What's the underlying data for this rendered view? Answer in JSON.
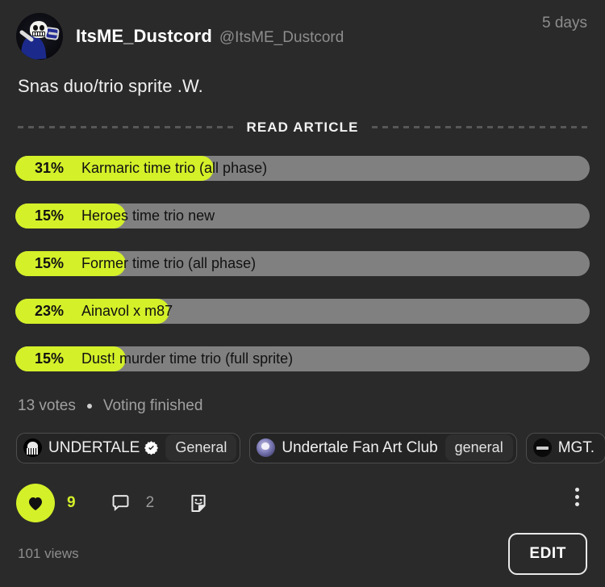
{
  "post": {
    "author": {
      "display_name": "ItsME_Dustcord",
      "handle": "@ItsME_Dustcord",
      "avatar_icon": "sans-skeleton-avatar"
    },
    "timestamp": "5 days",
    "text": "Snas duo/trio sprite .W.",
    "read_article_label": "READ ARTICLE"
  },
  "poll": {
    "options": [
      {
        "percent": "31%",
        "label": "Karmaric time trio (all phase)",
        "value": 31
      },
      {
        "percent": "15%",
        "label": "Heroes time trio new",
        "value": 15
      },
      {
        "percent": "15%",
        "label": "Former time trio (all phase)",
        "value": 15
      },
      {
        "percent": "23%",
        "label": "Ainavol x m87",
        "value": 23
      },
      {
        "percent": "15%",
        "label": "Dust! murder time trio (full sprite)",
        "value": 15
      }
    ],
    "votes_text": "13 votes",
    "status_text": "Voting finished",
    "fill_color": "#d4f029",
    "track_color": "#808080"
  },
  "tags": [
    {
      "name": "UNDERTALE",
      "channel": "General",
      "verified": true,
      "icon": "undertale-server-icon"
    },
    {
      "name": "Undertale Fan Art Club",
      "channel": "general",
      "verified": false,
      "icon": "fanart-server-icon"
    },
    {
      "name": "MGT.",
      "channel": "",
      "verified": false,
      "icon": "mgt-server-icon"
    }
  ],
  "actions": {
    "like_count": "9",
    "comment_count": "2",
    "like_icon": "heart-icon",
    "comment_icon": "comment-bubble-icon",
    "sticker_icon": "sticker-face-icon",
    "more_icon": "more-vertical-icon"
  },
  "footer": {
    "views": "101 views",
    "edit_label": "EDIT"
  }
}
